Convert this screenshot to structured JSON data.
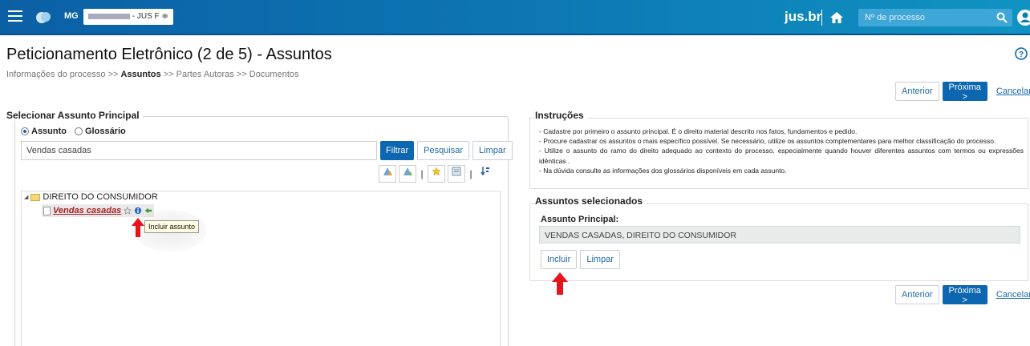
{
  "header": {
    "state": "MG",
    "org_select": "- JUS F ≑",
    "brand": "jus.br",
    "process_search_placeholder": "Nº de processo"
  },
  "page": {
    "title": "Peticionamento Eletrônico (2 de 5) - Assuntos",
    "breadcrumb": {
      "step1": "Informações do processo",
      "sep": ">>",
      "step2": "Assuntos",
      "step3": "Partes Autoras",
      "step4": "Documentos"
    }
  },
  "nav_buttons": {
    "previous": "Anterior",
    "next": "Próxima >",
    "cancel": "Cancelar"
  },
  "subject_selector": {
    "legend": "Selecionar Assunto Principal",
    "radio_subject": "Assunto",
    "radio_glossary": "Glossário",
    "search_value": "Vendas casadas",
    "filter_button": "Filtrar",
    "search_button": "Pesquisar",
    "clear_button": "Limpar",
    "tree": {
      "root": "DIREITO DO CONSUMIDOR",
      "child": "Vendas casadas"
    },
    "tooltip": "Incluir assunto"
  },
  "instructions": {
    "title": "Instruções",
    "lines": [
      "- Cadastre por primeiro o assunto principal. É o direito material descrito nos fatos, fundamentos e pedido.",
      "- Procure cadastrar os assuntos o mais específico possível. Se necessário, utilize os assuntos complementares para melhor classificação do processo.",
      "- Utilize o assunto do ramo do direito adequado ao contexto do processo, especialmente quando houver diferentes assuntos com termos ou expressões idênticas .",
      "- Na dúvida consulte as informações dos glossários disponíveis em cada assunto."
    ]
  },
  "selected": {
    "title": "Assuntos selecionados",
    "main_label": "Assunto Principal:",
    "main_value": "VENDAS CASADAS, DIREITO DO CONSUMIDOR",
    "include_button": "Incluir",
    "clear_button": "Limpar"
  },
  "colors": {
    "header": "#0d79b4",
    "primary": "#0d66b0",
    "annotation_arrow": "#e8141b"
  }
}
